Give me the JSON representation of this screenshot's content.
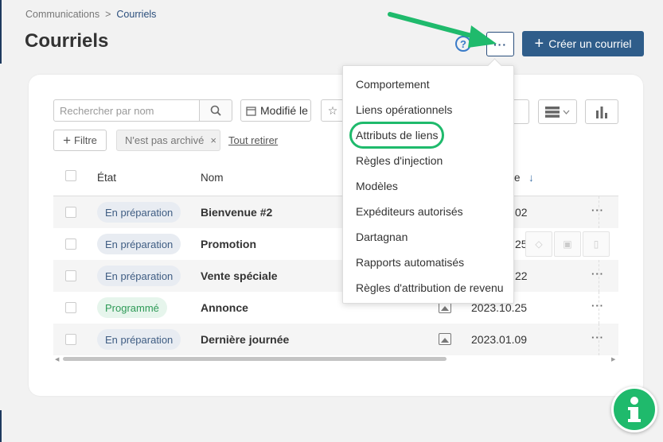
{
  "breadcrumb": {
    "parent": "Communications",
    "separator": ">",
    "current": "Courriels"
  },
  "page": {
    "title": "Courriels"
  },
  "header": {
    "help_glyph": "?",
    "more_glyph": "···",
    "create_label": "Créer un courriel"
  },
  "toolbar": {
    "search_placeholder": "Rechercher par nom",
    "modified_label": "Modifié le",
    "filter_label": "Filtre",
    "chip_label": "N'est pas archivé",
    "chip_close": "×",
    "remove_all_label": "Tout retirer"
  },
  "table": {
    "headers": {
      "state": "État",
      "name": "Nom",
      "date_suffix": "e",
      "sort_arrow": "↓"
    },
    "rows": [
      {
        "state": "En préparation",
        "state_kind": "prep",
        "name": "Bienvenue #2",
        "date": "2023.02.02",
        "date_visible": "02"
      },
      {
        "state": "En préparation",
        "state_kind": "prep",
        "name": "Promotion",
        "date_visible": "25"
      },
      {
        "state": "En préparation",
        "state_kind": "prep",
        "name": "Vente spéciale",
        "date_visible": "22"
      },
      {
        "state": "Programmé",
        "state_kind": "prog",
        "name": "Annonce",
        "date": "2023.10.25"
      },
      {
        "state": "En préparation",
        "state_kind": "prep",
        "name": "Dernière journée",
        "date": "2023.01.09"
      }
    ]
  },
  "menu": {
    "items": [
      "Comportement",
      "Liens opérationnels",
      "Attributs de liens",
      "Règles d'injection",
      "Modèles",
      "Expéditeurs autorisés",
      "Dartagnan",
      "Rapports automatisés",
      "Règles d'attribution de revenu"
    ],
    "highlighted": "Attributs de liens"
  },
  "colors": {
    "primary": "#2f5d8a",
    "annotation_green": "#1fba6c",
    "badge_prep": "#3f5d83",
    "badge_prog": "#2e9a57"
  },
  "row_dots": "···"
}
